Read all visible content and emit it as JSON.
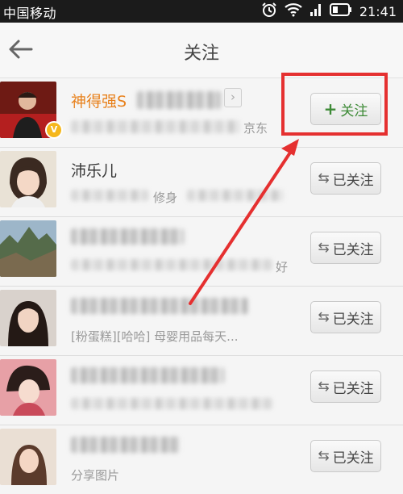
{
  "status_bar": {
    "carrier": "中国移动",
    "time": "21:41",
    "icons": [
      "alarm-clock-icon",
      "wifi-icon",
      "signal-icon",
      "battery-icon"
    ]
  },
  "header": {
    "back_icon": "back-arrow-icon",
    "title": "关注"
  },
  "users": [
    {
      "name": "神得强S",
      "subtitle": "京东",
      "button_label": "关注",
      "button_icon": "+",
      "verified": true
    },
    {
      "name": "沛乐儿",
      "subtitle": "修身",
      "button_label": "已关注",
      "button_icon": "⇆",
      "verified": false
    },
    {
      "name": "",
      "subtitle": "好",
      "button_label": "已关注",
      "button_icon": "⇆",
      "verified": false
    },
    {
      "name": "",
      "subtitle": "[粉蛋糕][哈哈] 母婴用品每天...",
      "button_label": "已关注",
      "button_icon": "⇆",
      "verified": false
    },
    {
      "name": "",
      "subtitle": "",
      "button_label": "已关注",
      "button_icon": "⇆",
      "verified": false
    },
    {
      "name": "",
      "subtitle": "分享图片",
      "button_label": "已关注",
      "button_icon": "⇆",
      "verified": false
    }
  ],
  "annotation": {
    "highlight_color": "#e53030"
  },
  "colors": {
    "name_accent": "#e8811c",
    "follow_green": "#3d8a36"
  }
}
